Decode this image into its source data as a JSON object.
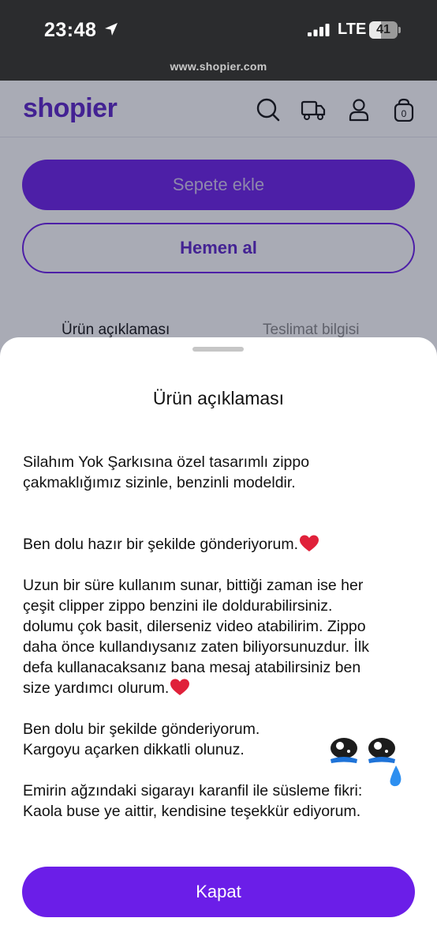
{
  "status_bar": {
    "time": "23:48",
    "network": "LTE",
    "battery": "41",
    "battery_level": 0.41,
    "url": "www.shopier.com"
  },
  "header": {
    "logo": "shopier",
    "icons": [
      "search-icon",
      "truck-icon",
      "user-icon",
      "bag-icon"
    ],
    "cart_count": "0"
  },
  "product_actions": {
    "add_to_cart": "Sepete ekle",
    "buy_now": "Hemen al"
  },
  "tabs": [
    {
      "label": "Ürün açıklaması",
      "active": true
    },
    {
      "label": "Teslimat bilgisi",
      "active": false
    }
  ],
  "sheet": {
    "title": "Ürün açıklaması",
    "paragraphs": [
      {
        "lines": [
          "Silahım Yok Şarkısına özel tasarımlı zippo",
          "çakmaklığımız sizinle, benzinli modeldir."
        ]
      },
      {
        "lines": [
          "Ben dolu hazır bir şekilde gönderiyorum."
        ]
      },
      {
        "lines": [
          "Uzun bir süre kullanım sunar, bittiği zaman ise her",
          "çeşit clipper zippo benzini ile doldurabilirsiniz.",
          "dolumu çok basit, dilerseniz video atabilirim. Zippo",
          "daha önce kullandıysanız zaten biliyorsunuzdur. İlk",
          "defa kullanacaksanız bana mesaj atabilirsiniz ben",
          "size yardımcı olurum."
        ]
      },
      {
        "lines": [
          "Ben dolu bir şekilde gönderiyorum.",
          "Kargoyu açarken dikkatli olunuz."
        ]
      },
      {
        "lines": [
          "Emirin ağzındaki sigarayı karanfil ile süsleme fikri:",
          "Kaola buse ye aittir, kendisine teşekkür ediyorum."
        ]
      }
    ],
    "close_button": "Kapat"
  },
  "colors": {
    "brand": "#6b1ee8",
    "logo": "#5b22c8",
    "status_bar": "#2b2c2e",
    "heart": "#e0213a"
  }
}
